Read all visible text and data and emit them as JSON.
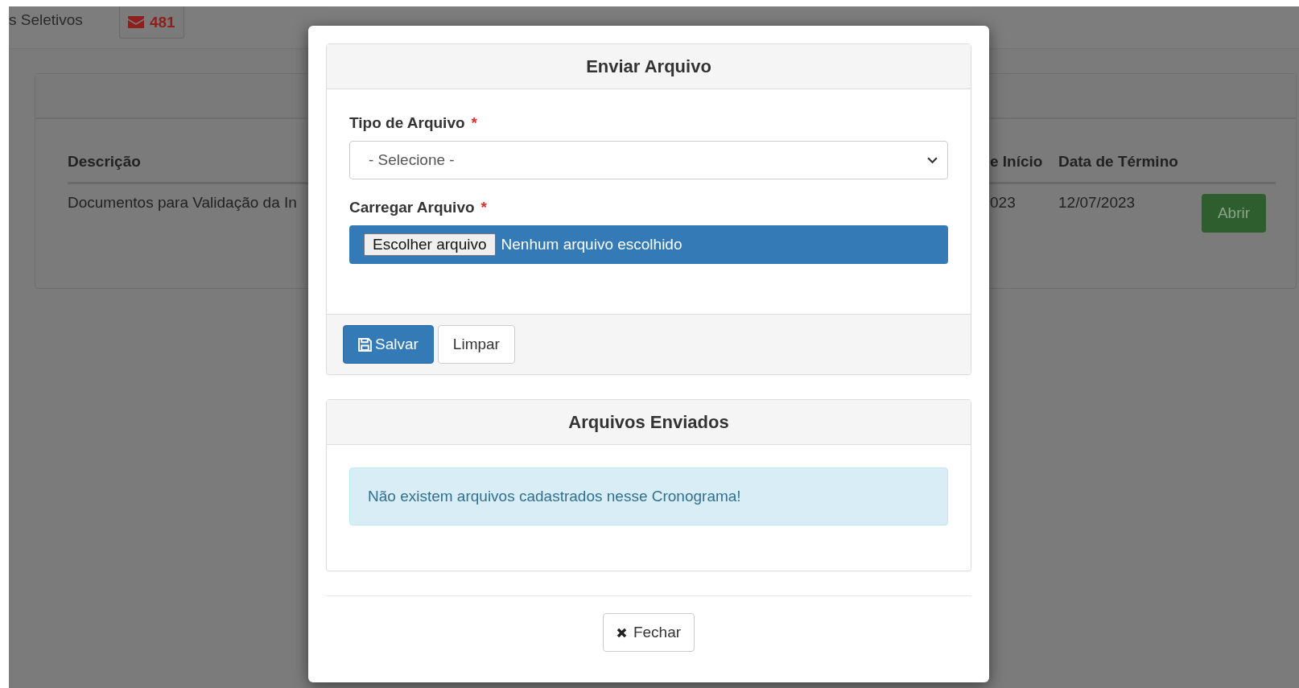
{
  "navbar": {
    "title": "s Seletivos",
    "messages_badge": "481"
  },
  "schedule_table": {
    "columns": [
      "Descrição",
      "e Início",
      "Data de Término"
    ],
    "rows": [
      {
        "description": "Documentos para Validação da In",
        "start": "023",
        "end": "12/07/2023",
        "action": "Abrir"
      }
    ]
  },
  "modal": {
    "upload_panel": {
      "title": "Enviar Arquivo",
      "fields": [
        {
          "kind": "select",
          "label": "Tipo de Arquivo",
          "required_mark": "*",
          "value": "- Selecione -"
        },
        {
          "kind": "file",
          "label": "Carregar Arquivo",
          "required_mark": "*",
          "button": "Escolher arquivo",
          "status": "Nenhum arquivo escolhido"
        }
      ],
      "buttons": [
        {
          "kind": "save",
          "label": "Salvar"
        },
        {
          "kind": "reset",
          "label": "Limpar"
        }
      ]
    },
    "sent_panel": {
      "title": "Arquivos Enviados",
      "empty_message": "Não existem arquivos cadastrados nesse Cronograma!"
    },
    "close_button": "Fechar"
  }
}
